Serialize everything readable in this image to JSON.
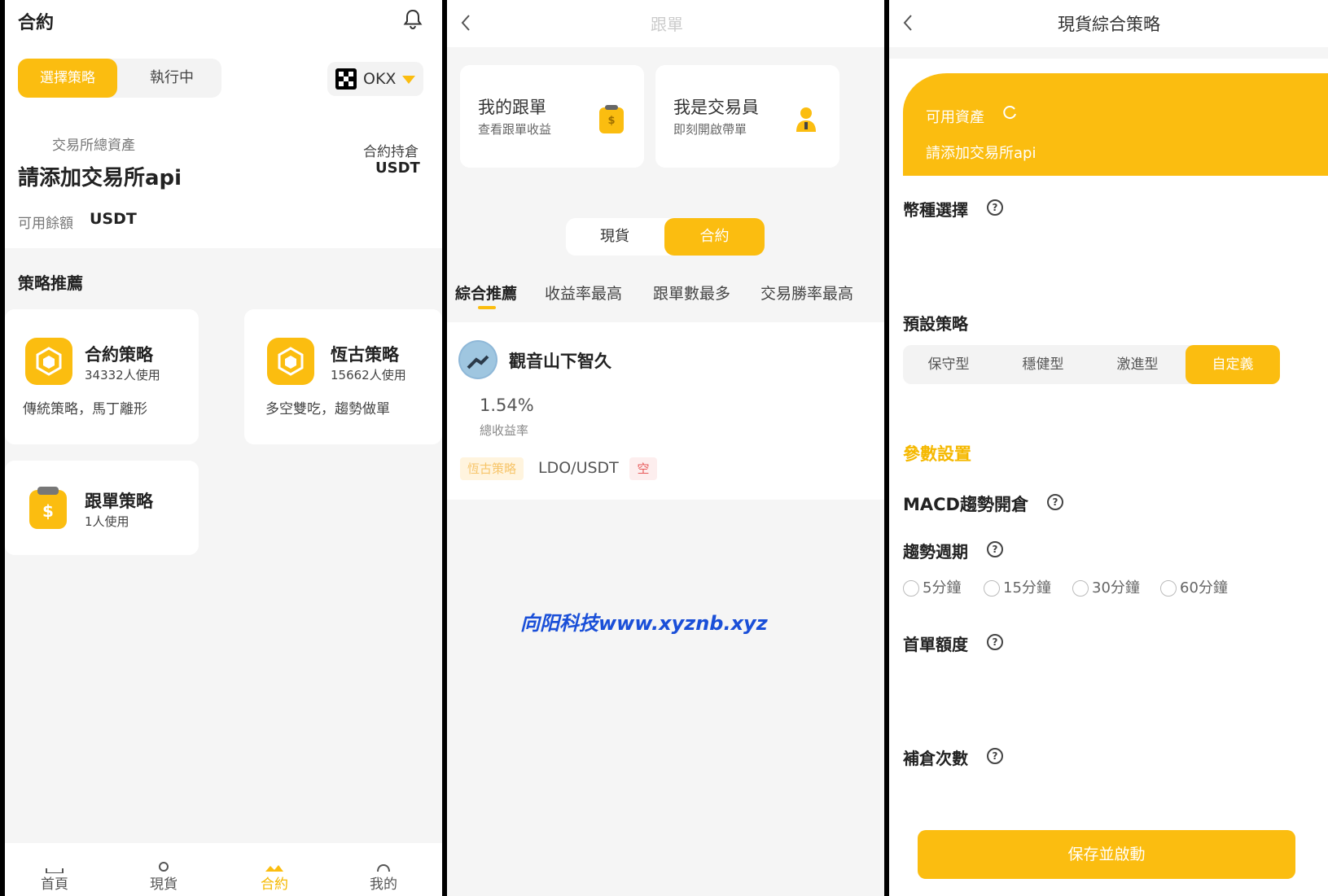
{
  "panel1": {
    "title": "合約",
    "tabs": [
      "選擇策略",
      "執行中"
    ],
    "exchange": "OKX",
    "total_assets_label": "交易所總資產",
    "add_api": "請添加交易所api",
    "holding_label": "合約持倉",
    "holding_unit": "USDT",
    "available_label": "可用餘額",
    "available_unit": "USDT",
    "section_title": "策略推薦",
    "strategies": [
      {
        "name": "合約策略",
        "users": "34332人使用",
        "desc": "傳統策略，馬丁離形"
      },
      {
        "name": "恆古策略",
        "users": "15662人使用",
        "desc": "多空雙吃，趨勢做單"
      },
      {
        "name": "跟單策略",
        "users": "1人使用",
        "desc": ""
      }
    ],
    "nav": [
      "首頁",
      "現貨",
      "合約",
      "我的"
    ]
  },
  "panel2": {
    "title": "跟單",
    "my_follow": {
      "title": "我的跟單",
      "sub": "查看跟單收益"
    },
    "trader": {
      "title": "我是交易員",
      "sub": "即刻開啟帶單"
    },
    "toggle": [
      "現貨",
      "合約"
    ],
    "tabs": [
      "綜合推薦",
      "收益率最高",
      "跟單數最多",
      "交易勝率最高"
    ],
    "item": {
      "name": "觀音山下智久",
      "rate": "1.54%",
      "rate_label": "總收益率",
      "tag": "恆古策略",
      "pair": "LDO/USDT",
      "direction": "空"
    },
    "watermark": "向阳科技www.xyznb.xyz"
  },
  "panel3": {
    "title": "現貨綜合策略",
    "available_label": "可用資產",
    "add_api": "請添加交易所api",
    "coin_select": "幣種選擇",
    "preset": "預設策略",
    "preset_options": [
      "保守型",
      "穩健型",
      "激進型",
      "自定義"
    ],
    "params": "參數設置",
    "macd": "MACD趨勢開倉",
    "period": "趨勢週期",
    "period_options": [
      "5分鐘",
      "15分鐘",
      "30分鐘",
      "60分鐘"
    ],
    "first_amount": "首單額度",
    "add_count": "補倉次數",
    "save": "保存並啟動"
  },
  "colors": {
    "accent": "#fbbd10",
    "short": "#e85a5a"
  }
}
